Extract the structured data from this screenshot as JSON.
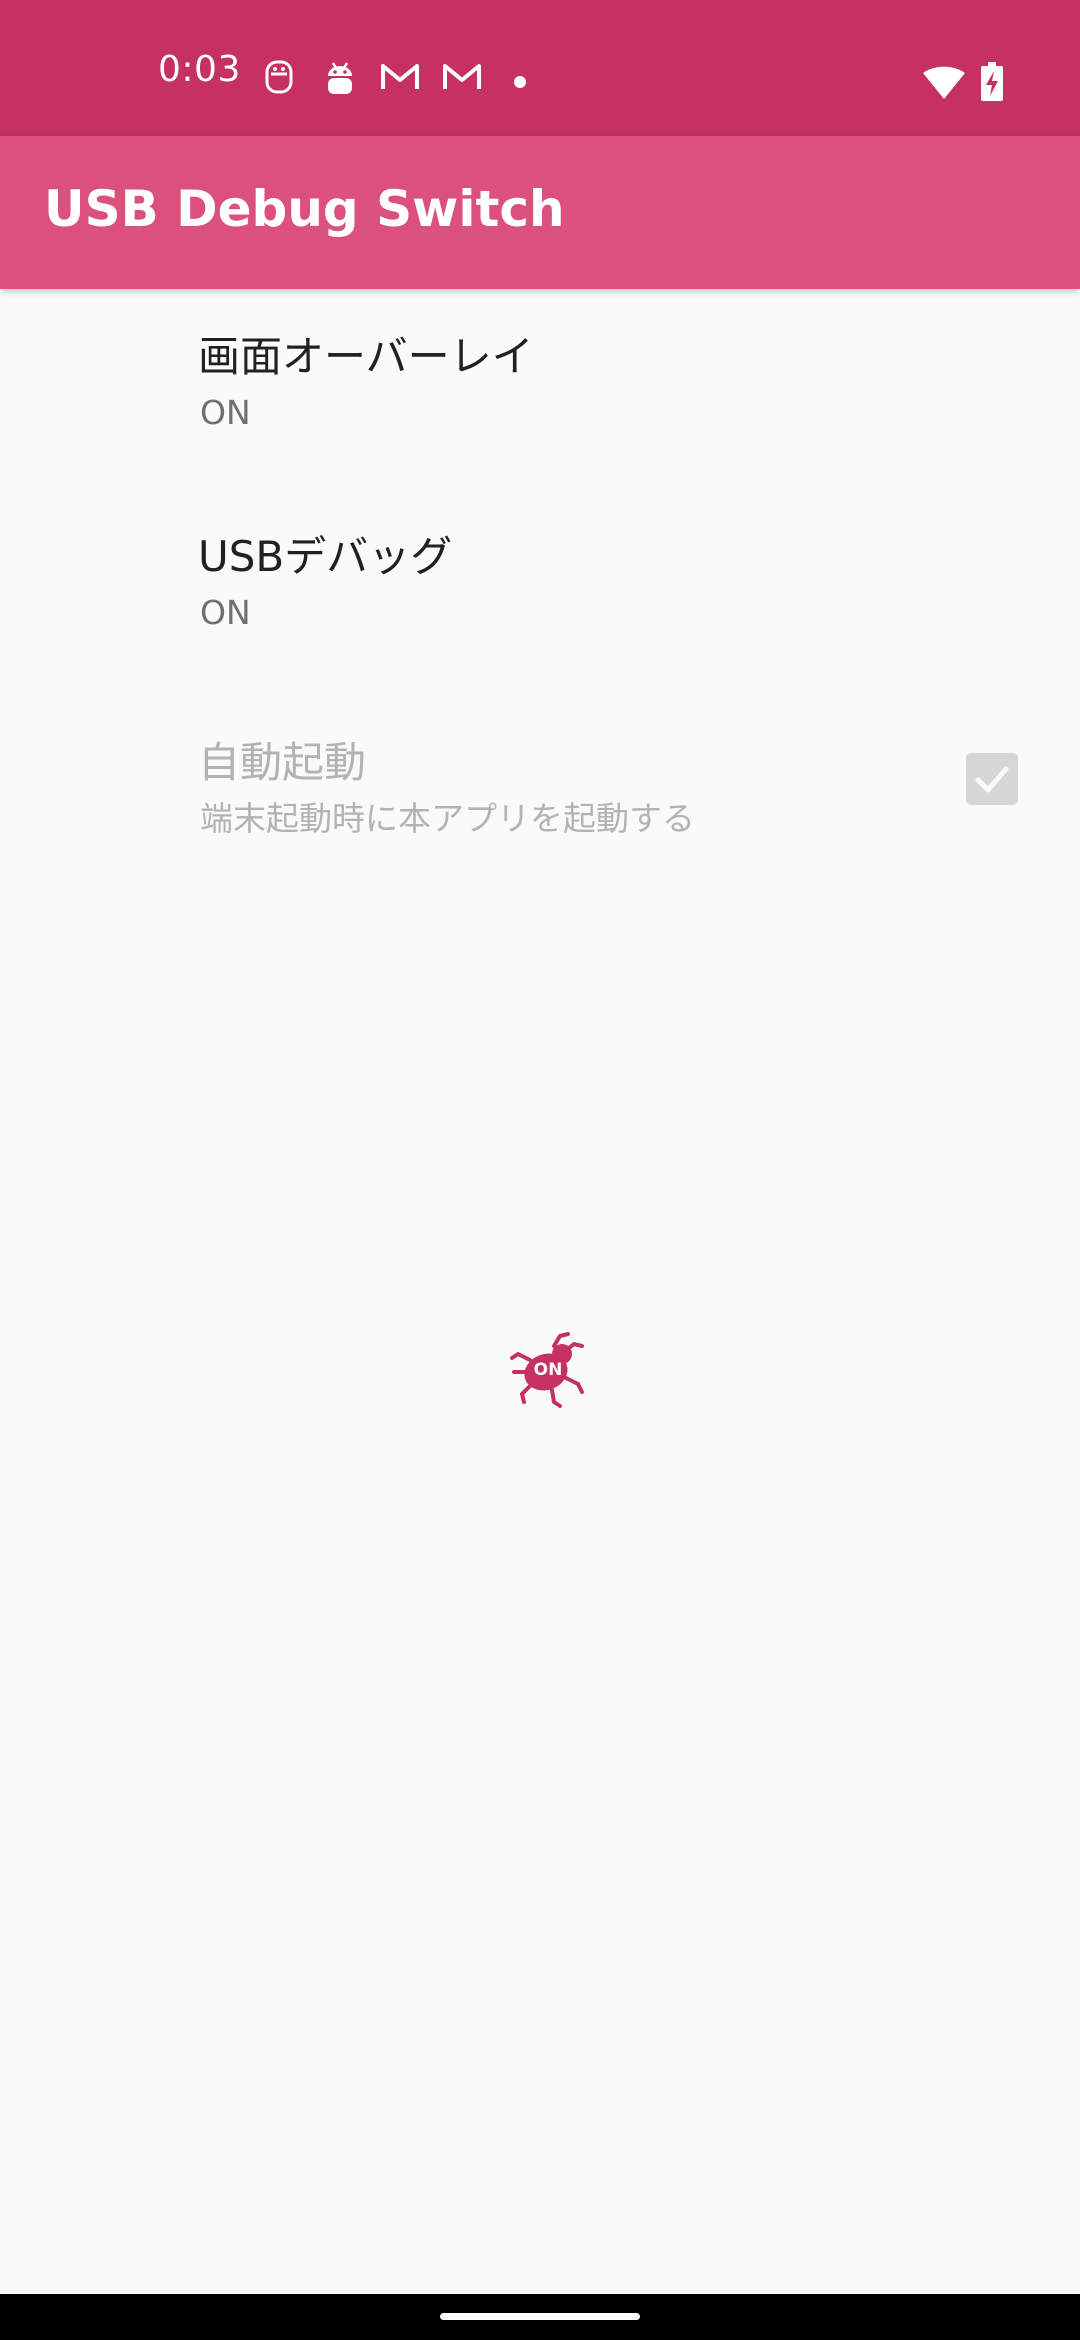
{
  "status_bar": {
    "time": "0:03",
    "icons": [
      "robot-face-icon",
      "android-icon",
      "gmail-icon",
      "gmail-icon",
      "dot-icon",
      "wifi-icon",
      "battery-charging-icon"
    ],
    "background": "#c5325f"
  },
  "app_bar": {
    "title": "USB Debug Switch",
    "background": "#db517b"
  },
  "preferences": [
    {
      "title": "画面オーバーレイ",
      "summary": "ON",
      "enabled": true
    },
    {
      "title": "USBデバッグ",
      "summary": "ON",
      "enabled": true
    },
    {
      "title": "自動起動",
      "summary": "端末起動時に本アプリを起動する",
      "enabled": false,
      "checked": true
    }
  ],
  "status_indicator": {
    "icon": "bug-on-icon",
    "label": "ON",
    "color": "#c5325f"
  }
}
